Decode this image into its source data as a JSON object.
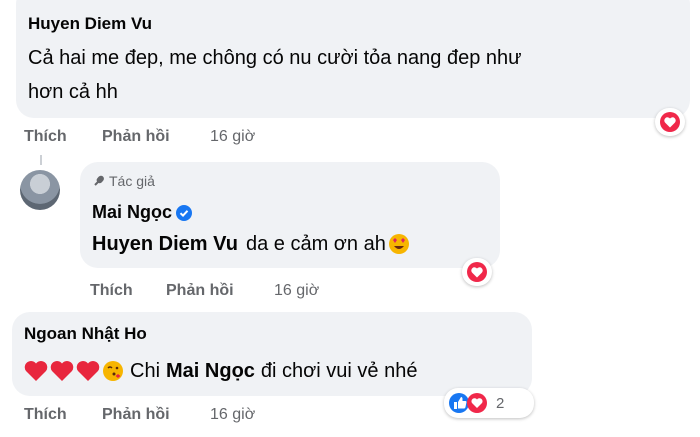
{
  "comments": [
    {
      "author": "Huyen Diem Vu",
      "text_line1": "Cả hai me đep, me chông có nu cười tỏa nang đep như",
      "text_line2": "hơn cả hh",
      "actions": {
        "like": "Thích",
        "reply": "Phản hồi",
        "time": "16 giờ"
      },
      "reaction": "love-react-icon"
    },
    {
      "badge": "Tác giả",
      "author": "Mai Ngọc",
      "mention": "Huyen Diem Vu",
      "text": "da e cảm ơn ah",
      "emoji": "heart-eyes-emoji",
      "actions": {
        "like": "Thích",
        "reply": "Phản hồi",
        "time": "16 giờ"
      },
      "reaction": "love-react-icon"
    },
    {
      "author": "Ngoan Nhật Ho",
      "text_prefix": "Chi",
      "mention": "Mai Ngọc",
      "text_suffix": "đi chơi vui vẻ nhé",
      "actions": {
        "like": "Thích",
        "reply": "Phản hồi",
        "time": "16 giờ"
      },
      "reaction_count": "2"
    }
  ],
  "colors": {
    "bubble": "#f0f2f5",
    "meta": "#65676b",
    "verified": "#1877f2",
    "love": "#f0284a"
  }
}
